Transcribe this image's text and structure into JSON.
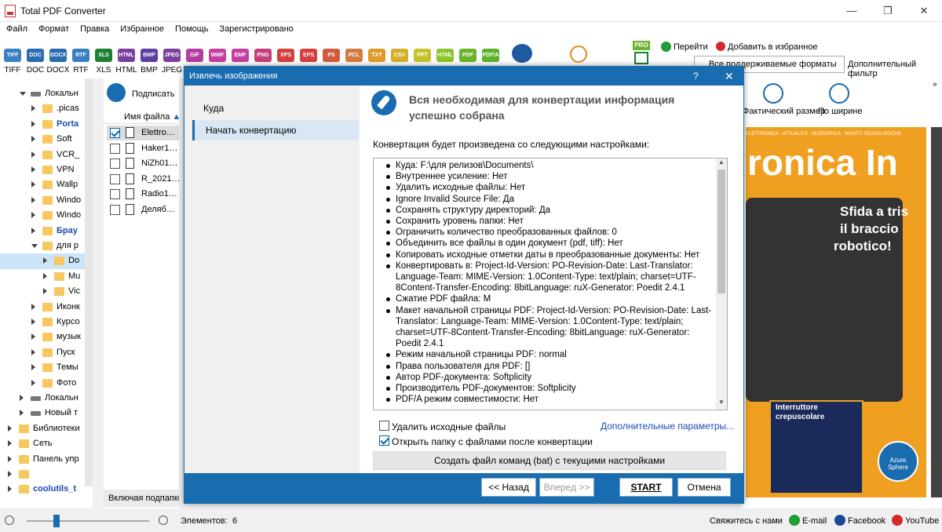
{
  "window": {
    "title": "Total PDF Converter"
  },
  "menu": [
    "Файл",
    "Формат",
    "Правка",
    "Избранное",
    "Помощь",
    "Зарегистрировано"
  ],
  "formats": [
    {
      "label": "TIFF",
      "color": "#3a7fc1"
    },
    {
      "label": "DOC",
      "color": "#2b6cb0"
    },
    {
      "label": "DOCX",
      "color": "#2b6cb0"
    },
    {
      "label": "RTF",
      "color": "#3a7fc1"
    },
    {
      "label": "XLS",
      "color": "#1e7e34"
    },
    {
      "label": "HTML",
      "color": "#7b3fa0"
    },
    {
      "label": "BMP",
      "color": "#5a3fa0"
    },
    {
      "label": "JPEG",
      "color": "#7b3fa0"
    },
    {
      "label": "GIF",
      "color": "#b03fa0"
    },
    {
      "label": "WMF",
      "color": "#c43fa0"
    },
    {
      "label": "EMF",
      "color": "#c43fa0"
    },
    {
      "label": "PNG",
      "color": "#c43f7a"
    },
    {
      "label": "XPS",
      "color": "#d43f3f"
    },
    {
      "label": "EPS",
      "color": "#d43f3f"
    },
    {
      "label": "PS",
      "color": "#d45a3f"
    },
    {
      "label": "PCL",
      "color": "#d47a3f"
    },
    {
      "label": "TXT",
      "color": "#e09a2a"
    },
    {
      "label": "CSV",
      "color": "#d4b02a"
    },
    {
      "label": "PPT",
      "color": "#c4c42a"
    },
    {
      "label": "HTML",
      "color": "#8ac42a"
    },
    {
      "label": "PDF",
      "color": "#6ab42a"
    },
    {
      "label": "PDF/A",
      "color": "#5ab42a"
    }
  ],
  "toolbar_right": {
    "go": "Перейти",
    "fav": "Добавить в избранное",
    "formats_select": "Все поддерживаемые форматы",
    "filter": "Дополнительный фильтр",
    "pro": "PRO"
  },
  "sign_btn": "Подписать",
  "file_header": "Имя файла",
  "tree": [
    {
      "label": "Локальн",
      "indent": 1,
      "type": "drive",
      "open": true
    },
    {
      "label": ".picas",
      "indent": 2,
      "type": "folder"
    },
    {
      "label": "Porta",
      "indent": 2,
      "type": "folder",
      "bold": true
    },
    {
      "label": "Soft",
      "indent": 2,
      "type": "folder"
    },
    {
      "label": "VCR_",
      "indent": 2,
      "type": "folder"
    },
    {
      "label": "VPN",
      "indent": 2,
      "type": "folder"
    },
    {
      "label": "Wallp",
      "indent": 2,
      "type": "folder"
    },
    {
      "label": "Windo",
      "indent": 2,
      "type": "folder"
    },
    {
      "label": "Windo",
      "indent": 2,
      "type": "folder"
    },
    {
      "label": "Брау",
      "indent": 2,
      "type": "folder",
      "bold": true
    },
    {
      "label": "для р",
      "indent": 2,
      "type": "folder",
      "open": true
    },
    {
      "label": "Do",
      "indent": 3,
      "type": "folder",
      "selected": true
    },
    {
      "label": "Mu",
      "indent": 3,
      "type": "folder"
    },
    {
      "label": "Vic",
      "indent": 3,
      "type": "folder"
    },
    {
      "label": "Иконк",
      "indent": 2,
      "type": "folder"
    },
    {
      "label": "Курсо",
      "indent": 2,
      "type": "folder"
    },
    {
      "label": "музык",
      "indent": 2,
      "type": "folder"
    },
    {
      "label": "Пуск",
      "indent": 2,
      "type": "folder"
    },
    {
      "label": "Темы",
      "indent": 2,
      "type": "folder"
    },
    {
      "label": "Фото",
      "indent": 2,
      "type": "folder"
    },
    {
      "label": "Локальн",
      "indent": 1,
      "type": "drive"
    },
    {
      "label": "Новый т",
      "indent": 1,
      "type": "drive"
    },
    {
      "label": "Библиотеки",
      "indent": 0,
      "type": "folder"
    },
    {
      "label": "Сеть",
      "indent": 0,
      "type": "folder"
    },
    {
      "label": "Панель упр",
      "indent": 0,
      "type": "folder"
    },
    {
      "label": "",
      "indent": 0,
      "type": "folder"
    },
    {
      "label": "coolutils_t",
      "indent": 0,
      "type": "folder",
      "bold": true
    }
  ],
  "files": [
    {
      "name": "Elettro…",
      "checked": true
    },
    {
      "name": "Haker1…",
      "checked": false
    },
    {
      "name": "NiZh01…",
      "checked": false
    },
    {
      "name": "R_2021…",
      "checked": false
    },
    {
      "name": "Radio1…",
      "checked": false
    },
    {
      "name": "Деляб…",
      "checked": false
    }
  ],
  "subfolders_label": "Включая подпапки",
  "preview": {
    "actual_size": "Фактический размер",
    "by_width": "По ширине",
    "mag_title": "ronica In",
    "mag_header": "ELETTRONICA · ATTUALITÀ · SCIENTIFICA · NOVITÀ TECNOLOGICHE",
    "mag_headline1": "Sfida a tris",
    "mag_headline2": "il braccio",
    "mag_headline3": "robotico!",
    "mag_box1": "Interruttore",
    "mag_box2": "crepuscolare",
    "mag_badge": "Azure Sphere"
  },
  "dialog": {
    "title": "Извлечь изображения",
    "help": "?",
    "nav": [
      "Куда",
      "Начать конвертацию"
    ],
    "heading1": "Вся необходимая для конвертации информация",
    "heading2": "успешно собрана",
    "intro": "Конвертация будет произведена со следующими настройками:",
    "settings": [
      "Куда: F:\\для релизов\\Documents\\",
      "Внутреннее усиление: Нет",
      "Удалить исходные файлы: Нет",
      "Ignore Invalid Source File: Да",
      "Сохранять структуру директорий: Да",
      "Сохранить уровень папки: Нет",
      "Ограничить количество преобразованных файлов: 0",
      "Объединить все файлы в один документ (pdf, tiff): Нет",
      "Копировать исходные отметки даты в преобразованные документы: Нет",
      "Конвертировать в: Project-Id-Version: PO-Revision-Date: Last-Translator: Language-Team: MIME-Version: 1.0Content-Type: text/plain; charset=UTF-8Content-Transfer-Encoding: 8bitLanguage: ruX-Generator: Poedit 2.4.1",
      "Сжатие PDF файла: M",
      "Макет начальной страницы PDF: Project-Id-Version: PO-Revision-Date: Last-Translator: Language-Team: MIME-Version: 1.0Content-Type: text/plain; charset=UTF-8Content-Transfer-Encoding: 8bitLanguage: ruX-Generator: Poedit 2.4.1",
      "Режим начальной страницы PDF: normal",
      "Права пользователя для PDF: []",
      "Автор PDF-документа: Softplicity",
      "Производитель PDF-документов: Softplicity",
      "PDF/A режим совместимости: Нет"
    ],
    "delete_src": "Удалить исходные файлы",
    "open_folder": "Открыть папку с файлами после конвертации",
    "more_params": "Дополнительные параметры...",
    "bat_btn": "Создать файл команд (bat) с текущими настройками",
    "back_btn": "<< Назад",
    "next_btn": "Вперед >>",
    "start_btn": "START",
    "cancel_btn": "Отмена"
  },
  "status": {
    "count_label": "Элементов:",
    "count": "6",
    "contact": "Свяжитесь с нами",
    "email": "E-mail",
    "facebook": "Facebook",
    "youtube": "YouTube"
  }
}
